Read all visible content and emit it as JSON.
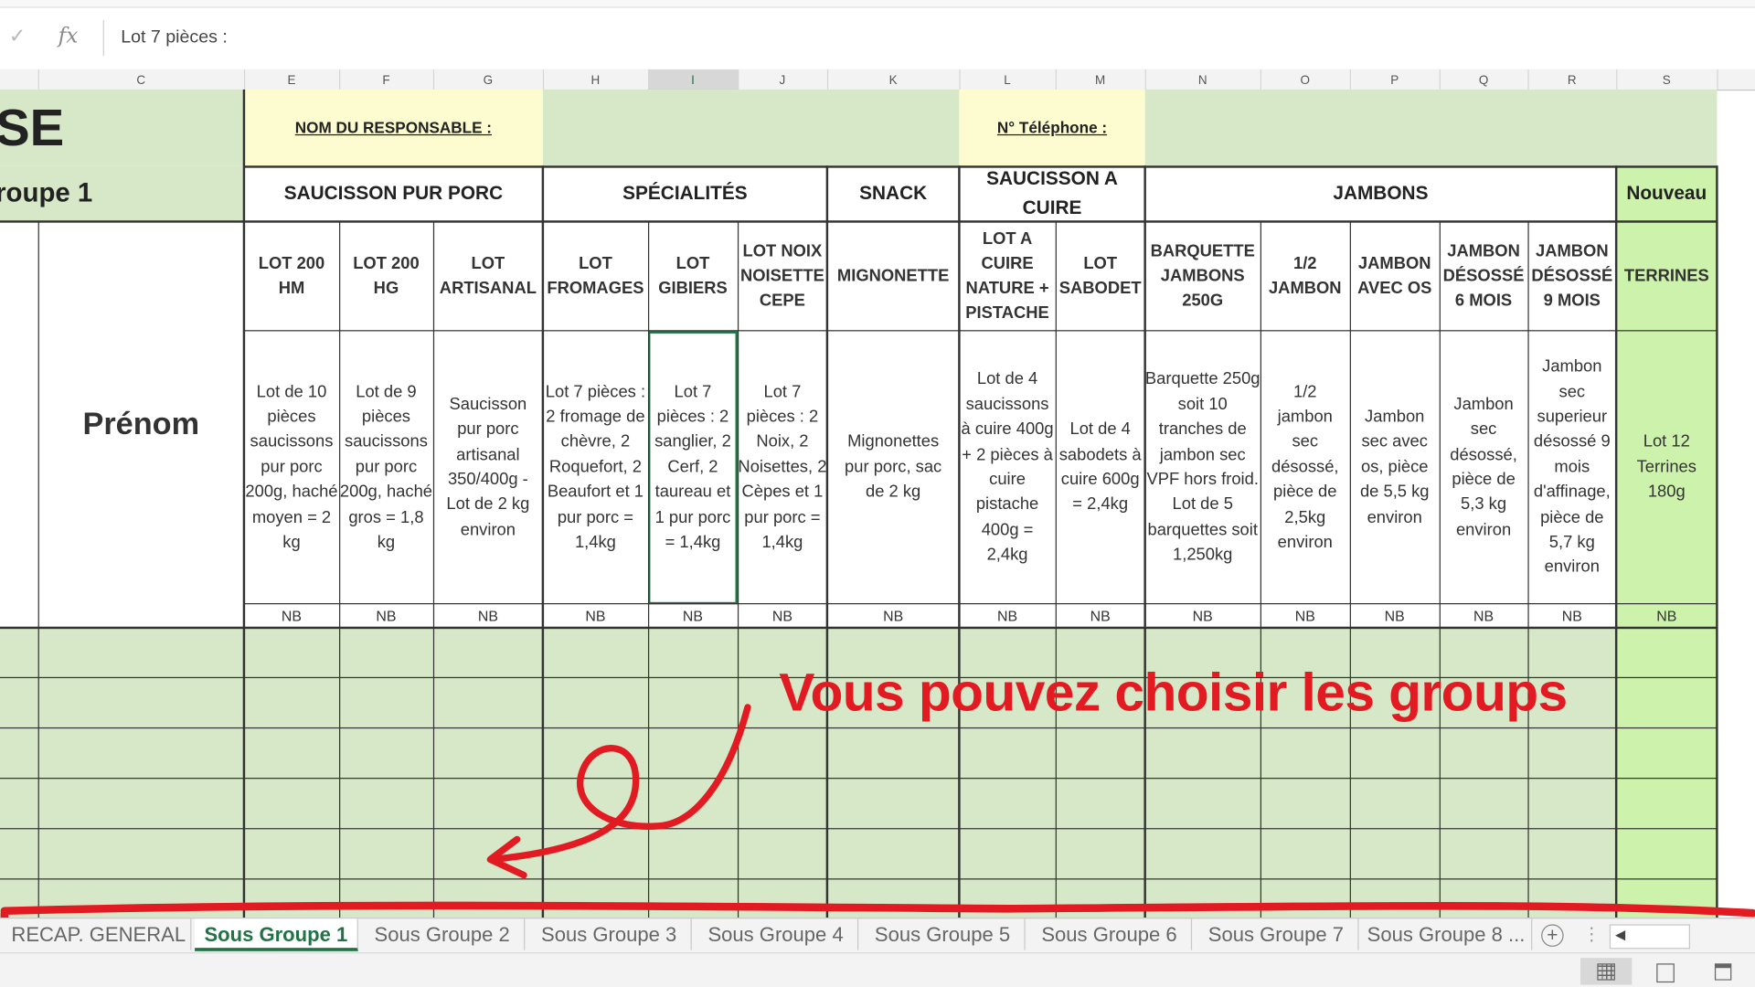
{
  "formula_bar": {
    "cancel_icon": "check-icon",
    "fx_label": "fx",
    "value": "Lot 7 pièces :"
  },
  "column_headers": [
    "C",
    "E",
    "F",
    "G",
    "H",
    "I",
    "J",
    "K",
    "L",
    "M",
    "N",
    "O",
    "P",
    "Q",
    "R",
    "S"
  ],
  "selected_column": "I",
  "title_partial": "SE",
  "group_label": "roupe 1",
  "responsable_label": "NOM DU RESPONSABLE :",
  "telephone_label": "N° Téléphone :",
  "prenom_label": "Prénom",
  "categories": {
    "saucisson": "SAUCISSON PUR PORC",
    "specialites": "SPÉCIALITÉS",
    "snack": "SNACK",
    "saucisson_cuire": "SAUCISSON A CUIRE",
    "jambons": "JAMBONS",
    "nouveau": "Nouveau"
  },
  "products": [
    {
      "name": "LOT 200 HM",
      "desc": "Lot de 10 pièces saucissons pur porc 200g, haché moyen = 2 kg",
      "nb": "NB"
    },
    {
      "name": "LOT 200 HG",
      "desc": "Lot de 9 pièces saucissons pur porc 200g, haché gros = 1,8 kg",
      "nb": "NB"
    },
    {
      "name": "LOT ARTISANAL",
      "desc": "Saucisson pur porc artisanal 350/400g - Lot de 2 kg environ",
      "nb": "NB"
    },
    {
      "name": "LOT FROMAGES",
      "desc": "Lot 7 pièces : 2 fromage de chèvre, 2 Roquefort, 2 Beaufort et 1 pur porc = 1,4kg",
      "nb": "NB"
    },
    {
      "name": "LOT GIBIERS",
      "desc": "Lot 7 pièces : 2 sanglier, 2 Cerf, 2 taureau et 1 pur porc = 1,4kg",
      "nb": "NB"
    },
    {
      "name": "LOT NOIX NOISETTE CEPE",
      "desc": "Lot 7 pièces : 2 Noix, 2 Noisettes, 2 Cèpes et 1 pur porc = 1,4kg",
      "nb": "NB"
    },
    {
      "name": "MIGNONETTE",
      "desc": "Mignonettes pur porc, sac de 2 kg",
      "nb": "NB"
    },
    {
      "name": "LOT A CUIRE NATURE + PISTACHE",
      "desc": "Lot de 4 saucissons à cuire 400g + 2 pièces à cuire pistache 400g = 2,4kg",
      "nb": "NB"
    },
    {
      "name": "LOT SABODET",
      "desc": "Lot de 4 sabodets à cuire 600g = 2,4kg",
      "nb": "NB"
    },
    {
      "name": "BARQUETTE JAMBONS 250G",
      "desc": "Barquette 250g soit 10 tranches de jambon sec VPF hors froid. Lot de 5 barquettes soit 1,250kg",
      "nb": "NB"
    },
    {
      "name": "1/2 JAMBON",
      "desc": "1/2 jambon sec désossé, pièce de 2,5kg environ",
      "nb": "NB"
    },
    {
      "name": "JAMBON AVEC OS",
      "desc": "Jambon sec avec os, pièce de 5,5 kg environ",
      "nb": "NB"
    },
    {
      "name": "JAMBON DÉSOSSÉ 6 MOIS",
      "desc": "Jambon sec désossé, pièce de 5,3 kg environ",
      "nb": "NB"
    },
    {
      "name": "JAMBON DÉSOSSÉ 9 MOIS",
      "desc": "Jambon sec superieur désossé 9 mois d'affinage, pièce de 5,7 kg environ",
      "nb": "NB"
    },
    {
      "name": "TERRINES",
      "desc": "Lot 12 Terrines 180g",
      "nb": "NB"
    }
  ],
  "annotation": {
    "text": "Vous pouvez choisir les groups",
    "color": "#e21b23"
  },
  "sheet_tabs": [
    "RECAP. GENERAL",
    "Sous Groupe 1",
    "Sous Groupe 2",
    "Sous Groupe 3",
    "Sous Groupe 4",
    "Sous Groupe 5",
    "Sous Groupe 6",
    "Sous Groupe 7",
    "Sous Groupe 8 ..."
  ],
  "active_tab": "Sous Groupe 1",
  "colors": {
    "green_fill": "#d6e8c8",
    "yellow_fill": "#fdfcd0",
    "bright_green": "#ccf2ac",
    "excel_green": "#217346"
  },
  "icons": {
    "add_sheet": "plus-circle-icon",
    "more": "vertical-dots-icon",
    "scroll_left": "triangle-left-icon",
    "normal_view": "grid-view-icon",
    "page_layout": "page-layout-icon",
    "page_break": "page-break-icon"
  }
}
